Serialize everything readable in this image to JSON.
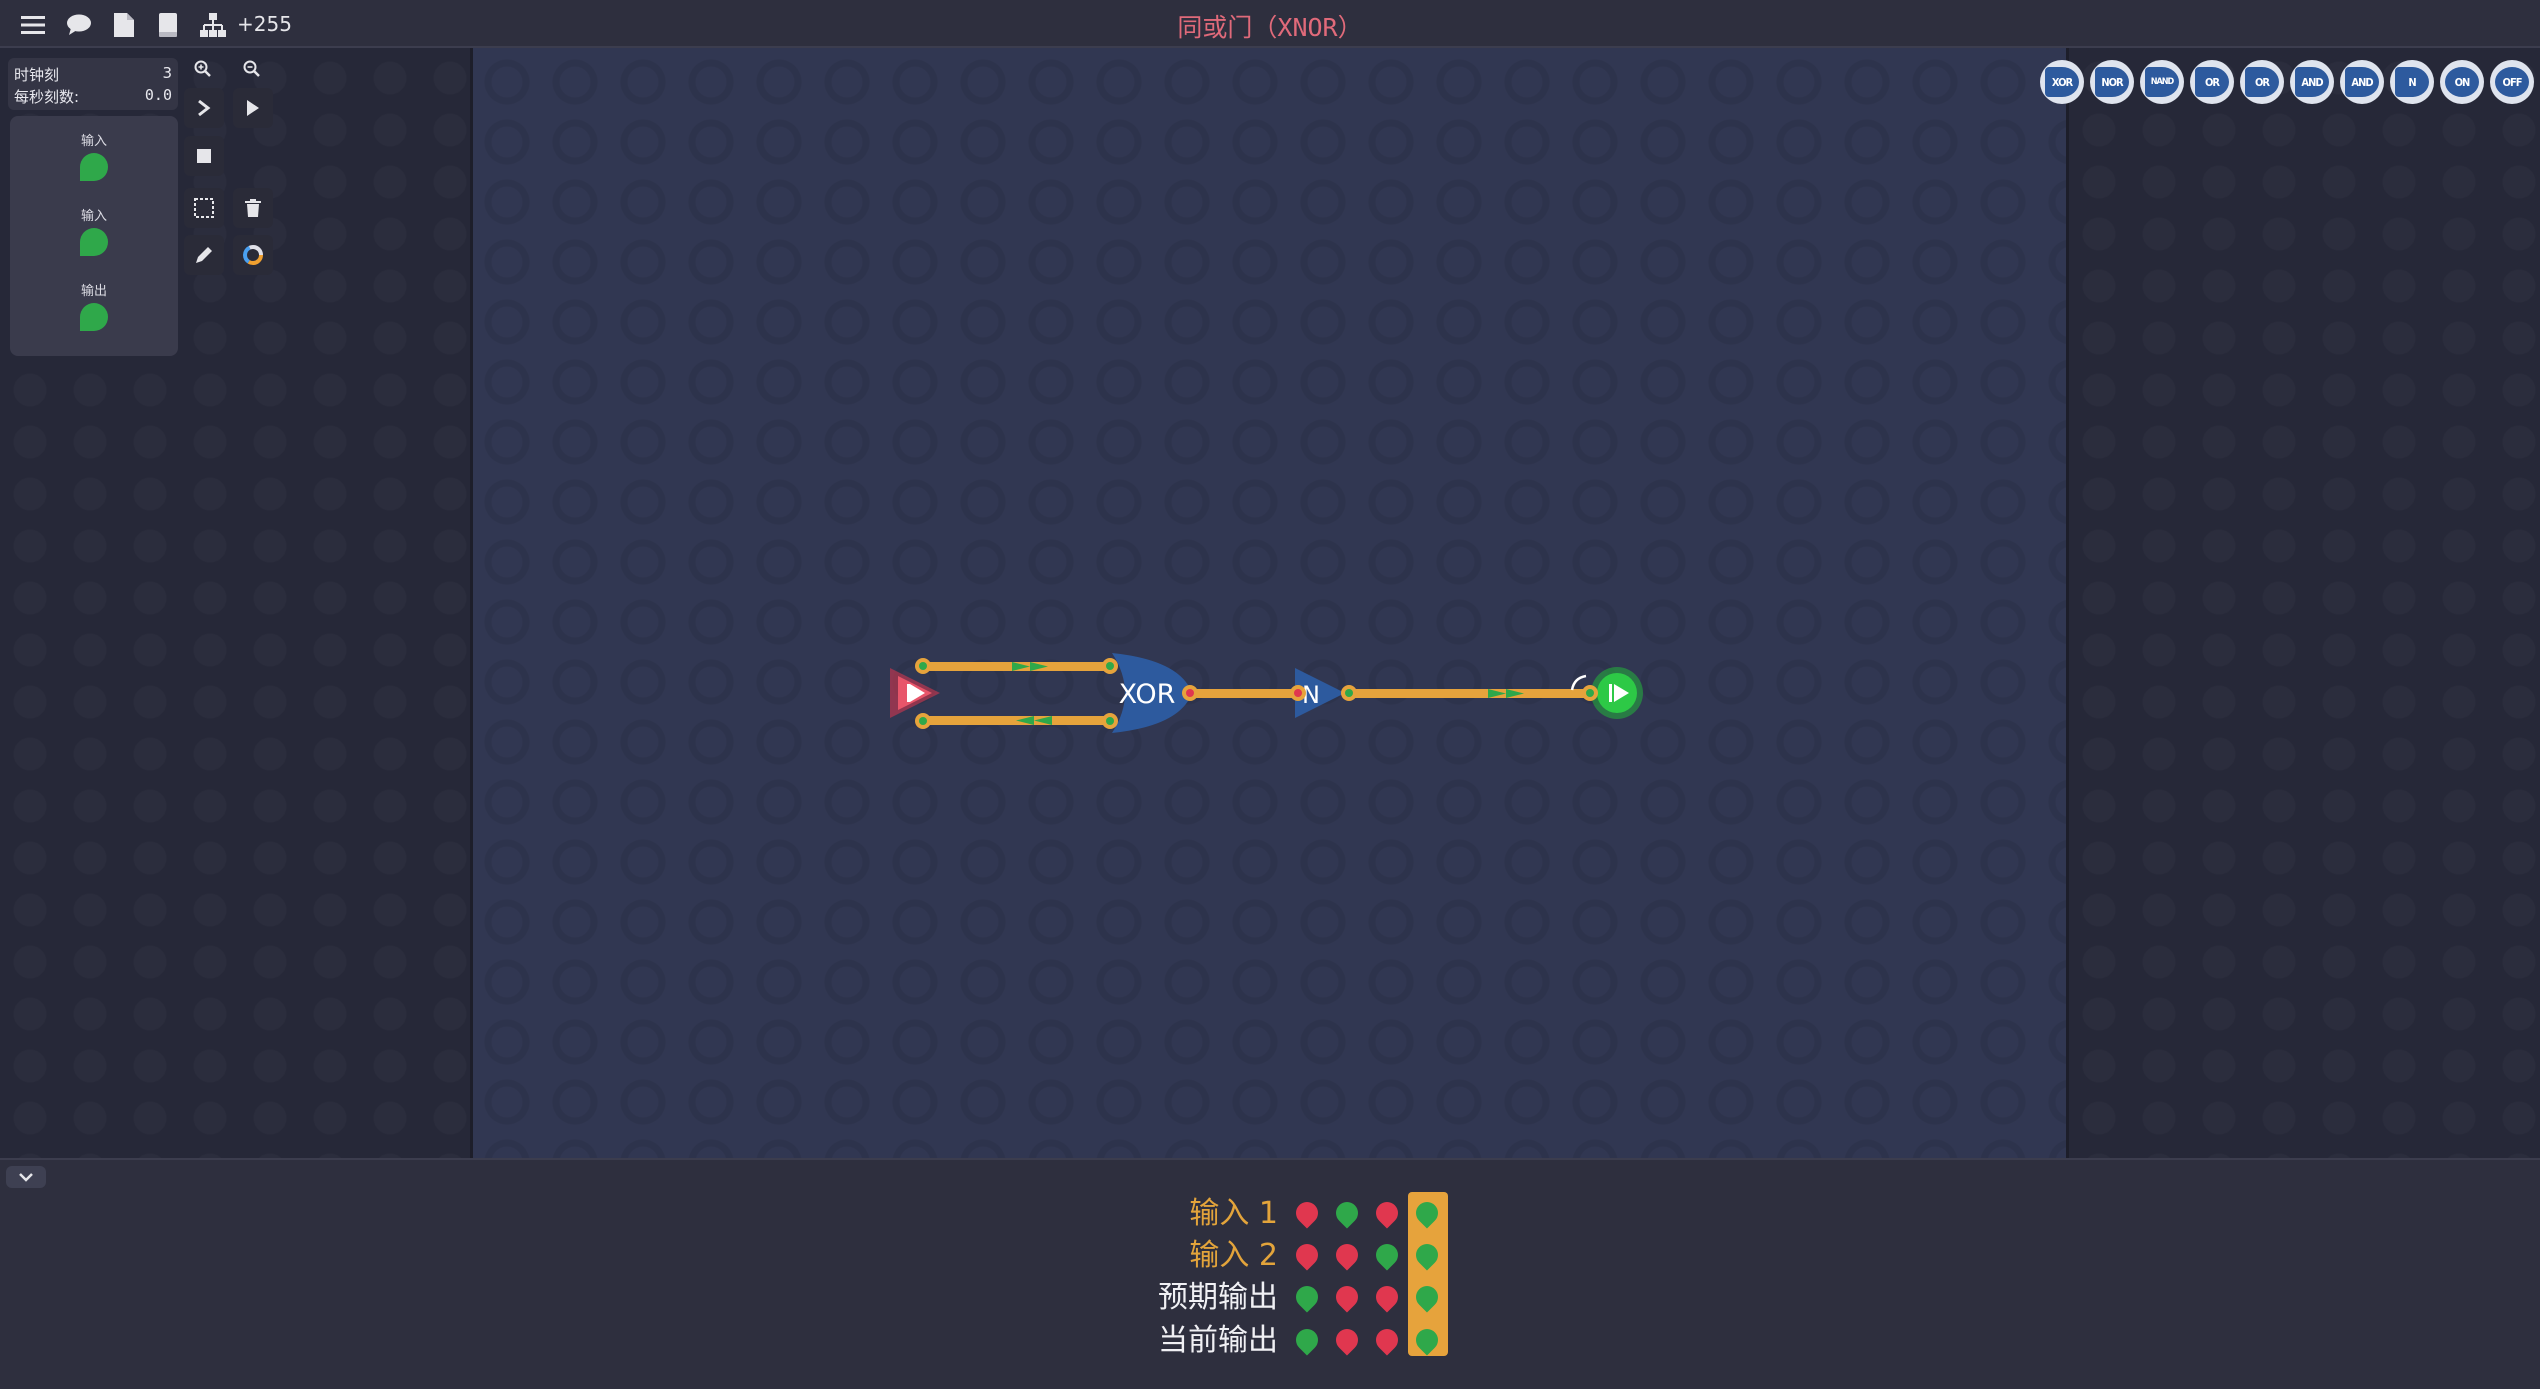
{
  "header": {
    "title": "同或门（XNOR）",
    "score": "+255",
    "icons": [
      "menu-icon",
      "chat-icon",
      "file-icon",
      "book-icon",
      "hierarchy-icon"
    ]
  },
  "clock": {
    "tick_label": "时钟刻",
    "tick_value": "3",
    "tps_label": "每秒刻数:",
    "tps_value": "0.0"
  },
  "io_list": [
    {
      "label": "输入",
      "state": "on"
    },
    {
      "label": "输入",
      "state": "on"
    },
    {
      "label": "输出",
      "state": "on"
    }
  ],
  "tools": [
    "zoom-in-icon",
    "zoom-out-icon",
    "step-icon",
    "play-icon",
    "stop-icon",
    "select-icon",
    "delete-icon",
    "pencil-icon",
    "color-wheel-icon"
  ],
  "palette": [
    {
      "label": "XOR"
    },
    {
      "label": "NOR"
    },
    {
      "label": "NAND"
    },
    {
      "label": "OR"
    },
    {
      "label": "OR"
    },
    {
      "label": "AND"
    },
    {
      "label": "AND"
    },
    {
      "label": "N"
    },
    {
      "label": "ON"
    },
    {
      "label": "OFF"
    }
  ],
  "circuit": {
    "xor_label": "XOR",
    "not_label": "N"
  },
  "truth_table": {
    "rows": [
      {
        "label": "输入 1",
        "kind": "input",
        "values": [
          "r",
          "g",
          "r",
          "g"
        ]
      },
      {
        "label": "输入 2",
        "kind": "input",
        "values": [
          "r",
          "r",
          "g",
          "g"
        ]
      },
      {
        "label": "预期输出",
        "kind": "output",
        "values": [
          "g",
          "r",
          "r",
          "g"
        ]
      },
      {
        "label": "当前输出",
        "kind": "output",
        "values": [
          "g",
          "r",
          "r",
          "g"
        ]
      }
    ],
    "highlight_column": 4
  },
  "colors": {
    "green": "#2fa84a",
    "red": "#e0374f",
    "wire": "#e6a33c",
    "accent_title": "#e06a7a"
  }
}
